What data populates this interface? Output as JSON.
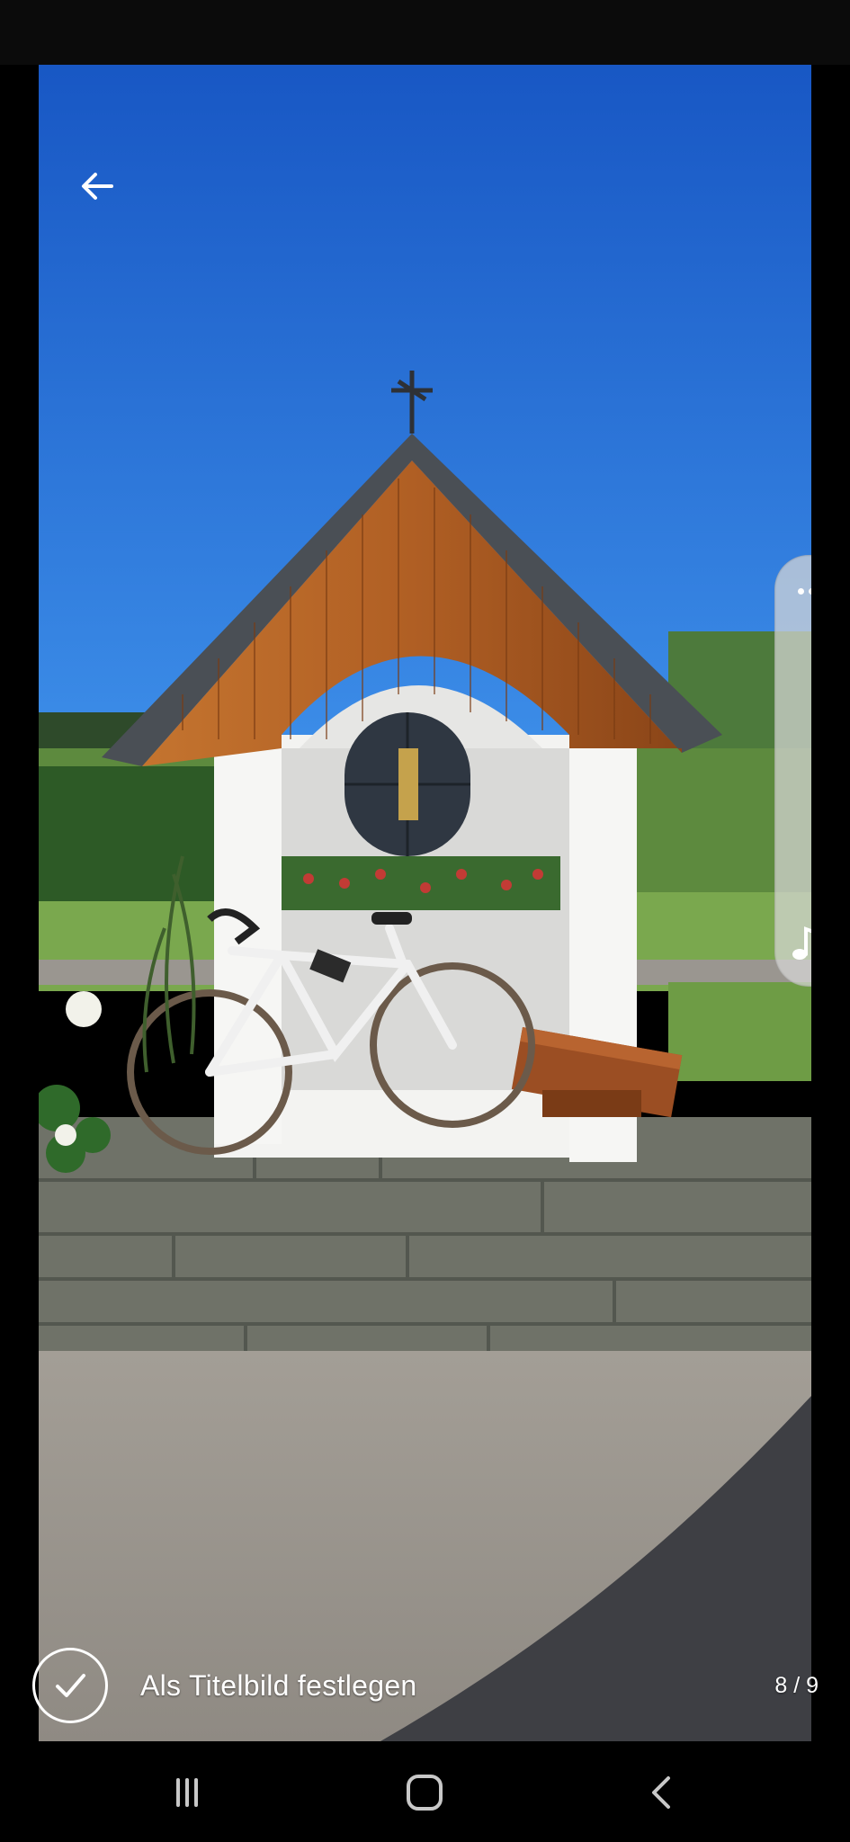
{
  "viewer": {
    "photo_description_icon": "photo",
    "back_icon": "arrow-left-icon",
    "more_icon": "more-horizontal-icon",
    "sound_icon": "music-note-sound-icon"
  },
  "bottom": {
    "set_cover_label": "Als Titelbild festlegen",
    "page_counter": "8 / 9"
  },
  "nav": {
    "recents_icon": "recents-icon",
    "home_icon": "home-icon",
    "back_icon": "chevron-left-icon"
  },
  "colors": {
    "sky": "#1f6fd4",
    "roof_wood": "#b8692c",
    "panel": "#d7d7d7",
    "nav_icon": "#c8c8c8"
  }
}
